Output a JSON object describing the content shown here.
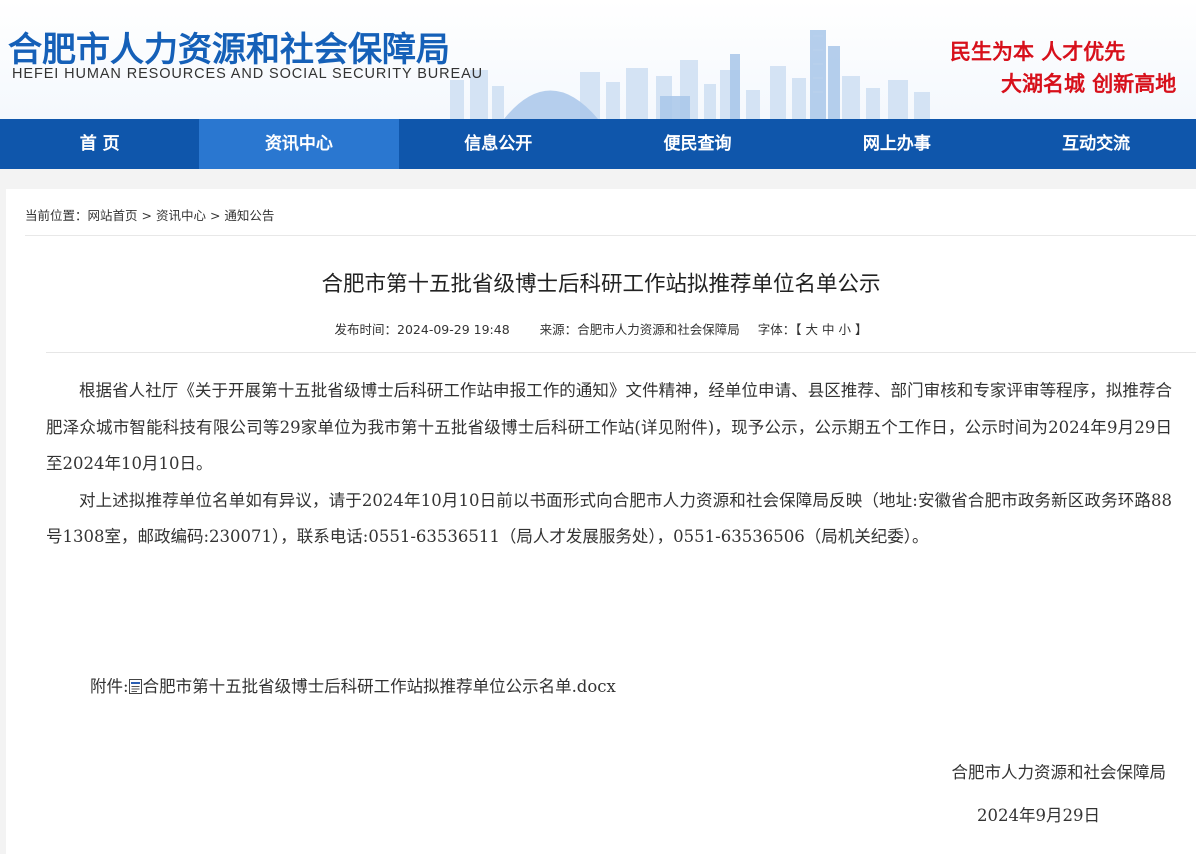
{
  "header": {
    "logo_cn": "合肥市人力资源和社会保障局",
    "logo_en": "HEFEI HUMAN RESOURCES AND SOCIAL SECURITY BUREAU",
    "slogan_1": "民生为本  人才优先",
    "slogan_2": "大湖名城  创新高地",
    "brand_color": "#1560b8",
    "slogan_color": "#d7101b"
  },
  "nav": {
    "items": [
      {
        "label": "首 页"
      },
      {
        "label": "资讯中心"
      },
      {
        "label": "信息公开"
      },
      {
        "label": "便民查询"
      },
      {
        "label": "网上办事"
      },
      {
        "label": "互动交流"
      }
    ],
    "active_index": 1,
    "bg_color": "#0f56ab",
    "active_color": "#2a77d0"
  },
  "breadcrumb": {
    "prefix": "当前位置：",
    "items": [
      "网站首页",
      "资讯中心",
      "通知公告"
    ],
    "separator": " > "
  },
  "article": {
    "title": "合肥市第十五批省级博士后科研工作站拟推荐单位名单公示",
    "meta": {
      "publish_label": "发布时间：",
      "publish_time": "2024-09-29 19:48",
      "source_label": "来源：",
      "source": "合肥市人力资源和社会保障局",
      "font_label": "字体：",
      "font_open": "【",
      "font_large": "大",
      "font_medium": "中",
      "font_small": "小",
      "font_close": "】"
    },
    "paragraphs": [
      "根据省人社厅《关于开展第十五批省级博士后科研工作站申报工作的通知》文件精神，经单位申请、县区推荐、部门审核和专家评审等程序，拟推荐合肥泽众城市智能科技有限公司等29家单位为我市第十五批省级博士后科研工作站(详见附件)，现予公示，公示期五个工作日，公示时间为2024年9月29日至2024年10月10日。",
      "对上述拟推荐单位名单如有异议，请于2024年10月10日前以书面形式向合肥市人力资源和社会保障局反映（地址:安徽省合肥市政务新区政务环路88号1308室，邮政编码:230071），联系电话:0551-63536511（局人才发展服务处），0551-63536506（局机关纪委）。"
    ],
    "attachment_label": "附件:",
    "attachment_name": "合肥市第十五批省级博士后科研工作站拟推荐单位公示名单.docx",
    "attachment_icon": "word-doc-icon",
    "signature_org": "合肥市人力资源和社会保障局",
    "signature_date": "2024年9月29日"
  }
}
